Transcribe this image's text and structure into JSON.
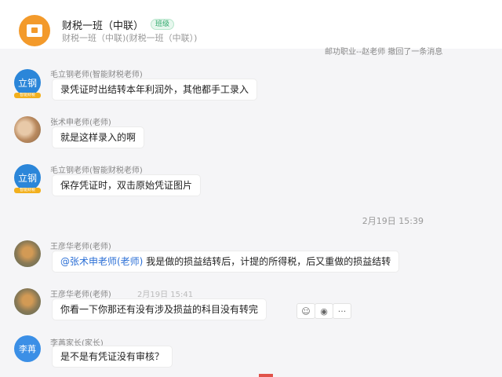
{
  "header": {
    "title": "财税一班（中联）",
    "badge": "班级",
    "subtitle": "财税一班（中联)(财税一班（中联）)",
    "notice": "邮功职业--赵老师 撤回了一条消息"
  },
  "messages": [
    {
      "sender": "毛立钢老师(智能财税老师)",
      "avatar_text": "立钢",
      "avatar_tag": "智能财税",
      "text": "录凭证时出结转本年利润外，其他都手工录入"
    },
    {
      "sender": "张术申老师(老师)",
      "text": "就是这样录入的啊"
    },
    {
      "sender": "毛立钢老师(智能财税老师)",
      "avatar_text": "立钢",
      "avatar_tag": "智能财税",
      "text": "保存凭证时，双击原始凭证图片"
    },
    {
      "sender": "王彦华老师(老师)",
      "mention": "@张术申老师(老师)",
      "text": " 我是做的损益结转后，计提的所得税，后又重做的损益结转"
    },
    {
      "sender": "王彦华老师(老师)",
      "time": "2月19日  15:41",
      "text": "你看一下你那还有没有涉及损益的科目没有转完"
    },
    {
      "sender": "李苒家长(家长)",
      "avatar_text": "李苒",
      "text": "是不是有凭证没有审核？"
    }
  ],
  "divider_time": "2月19日  15:39",
  "reactions": {
    "emoji": "☺",
    "view": "◉",
    "more": "···"
  },
  "colors": {
    "accent": "#2b6fd6",
    "group_avatar": "#f39a2b",
    "badge": "#2fa86b"
  },
  "icons": {
    "group": "book-icon"
  }
}
